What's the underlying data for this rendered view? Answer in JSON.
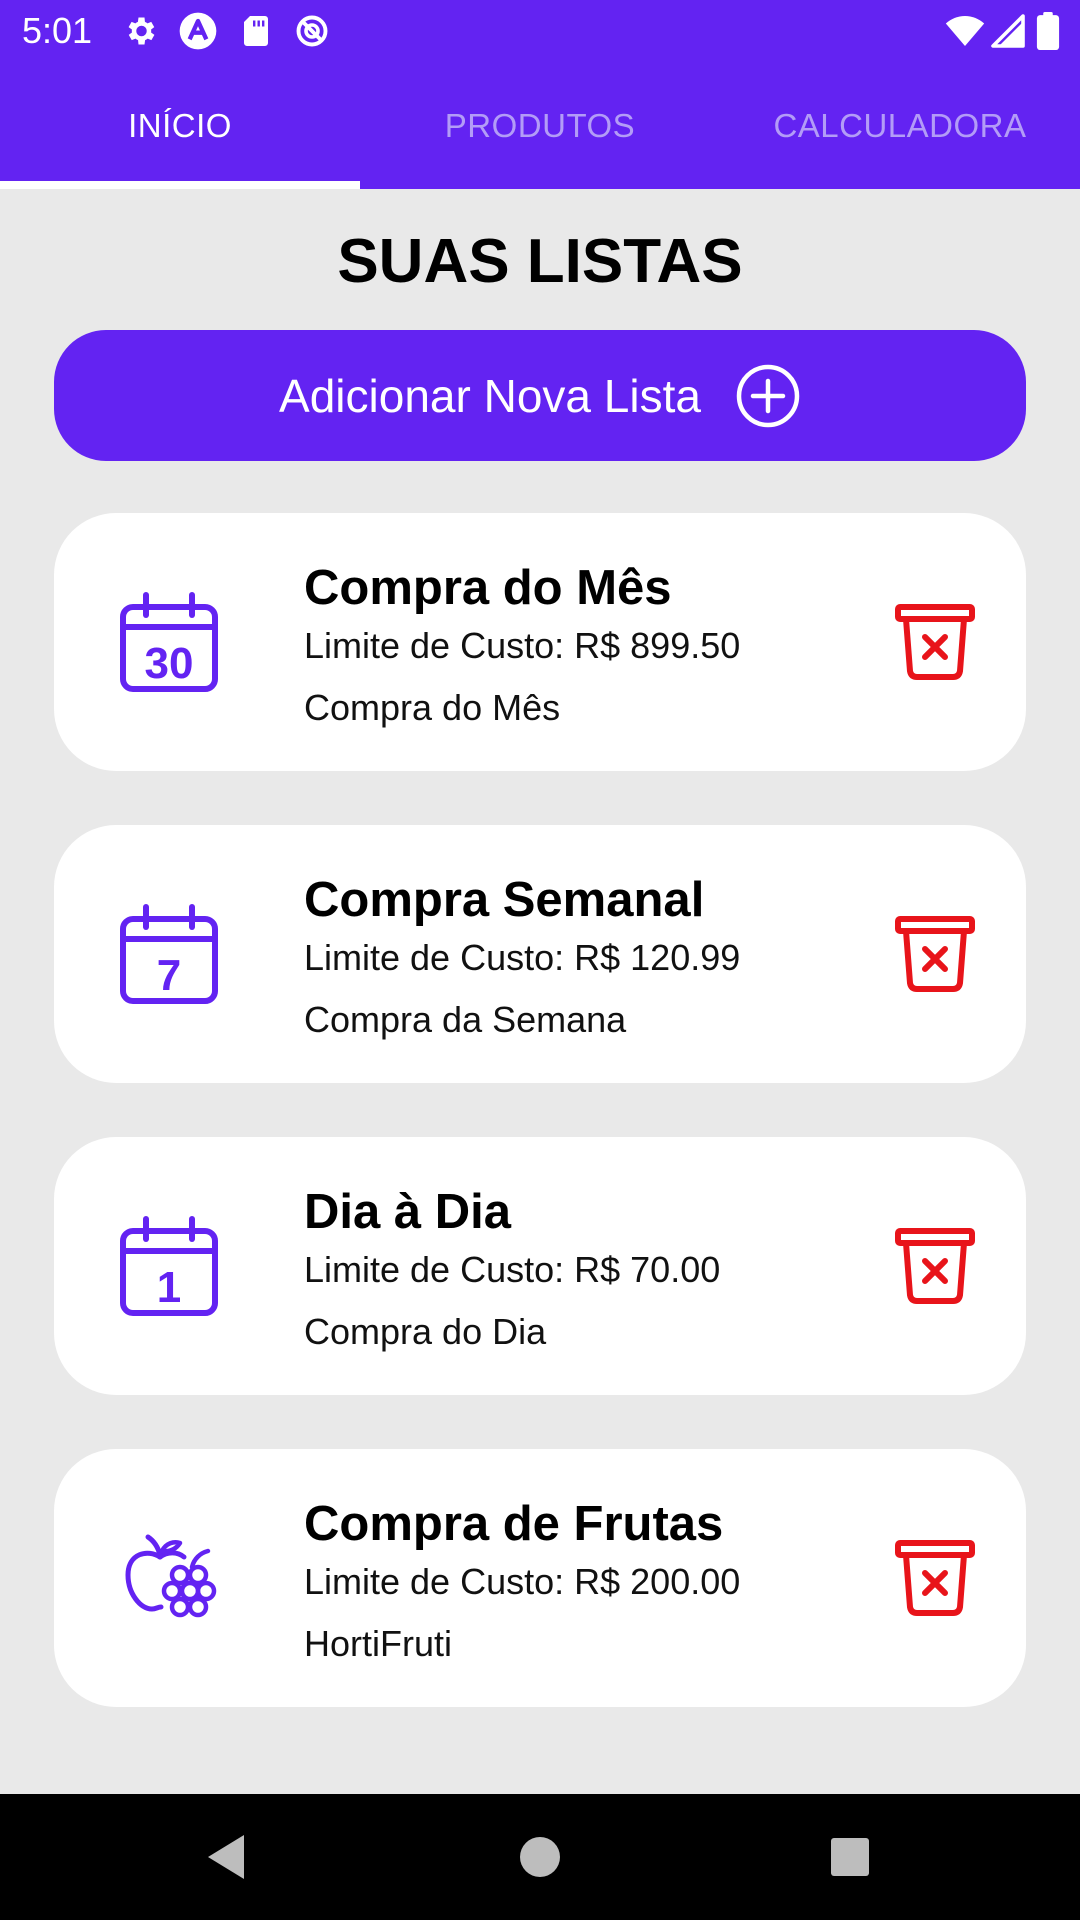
{
  "status_bar": {
    "time": "5:01",
    "left_icons": [
      "gear-icon",
      "app-logo-icon",
      "sd-card-icon",
      "sync-blocked-icon"
    ],
    "right_icons": [
      "wifi-icon",
      "signal-icon",
      "battery-icon"
    ]
  },
  "tabs": [
    {
      "label": "INÍCIO",
      "active": true
    },
    {
      "label": "PRODUTOS",
      "active": false
    },
    {
      "label": "CALCULADORA",
      "active": false
    }
  ],
  "main": {
    "title": "SUAS LISTAS",
    "add_button_label": "Adicionar Nova Lista",
    "lists": [
      {
        "icon": "calendar-30-icon",
        "icon_text": "30",
        "title": "Compra do Mês",
        "limit": "Limite de Custo: R$ 899.50",
        "description": "Compra do Mês"
      },
      {
        "icon": "calendar-7-icon",
        "icon_text": "7",
        "title": "Compra Semanal",
        "limit": "Limite de Custo: R$ 120.99",
        "description": "Compra da Semana"
      },
      {
        "icon": "calendar-1-icon",
        "icon_text": "1",
        "title": "Dia à Dia",
        "limit": "Limite de Custo: R$ 70.00",
        "description": "Compra do Dia"
      },
      {
        "icon": "fruits-icon",
        "title": "Compra de Frutas",
        "limit": "Limite de Custo: R$ 200.00",
        "description": "HortiFruti"
      }
    ]
  },
  "nav_bar": {
    "buttons": [
      "back-icon",
      "home-icon",
      "recents-icon"
    ]
  },
  "colors": {
    "primary": "#6323f2",
    "tab_inactive": "#b39cf7",
    "background": "#e9e9e9",
    "delete": "#e8141a",
    "card": "#ffffff"
  }
}
